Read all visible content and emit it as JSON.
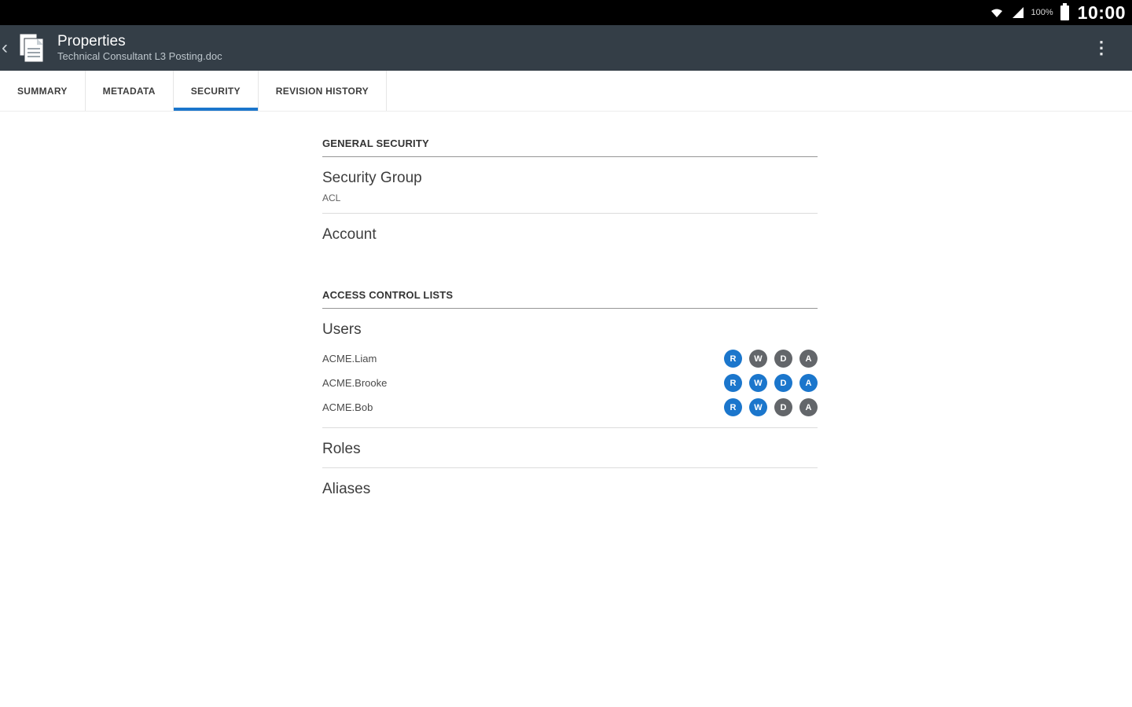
{
  "status_bar": {
    "time": "10:00",
    "battery_level": "100%"
  },
  "app_bar": {
    "back_icon": "‹",
    "title": "Properties",
    "subtitle": "Technical Consultant L3 Posting.doc",
    "overflow_icon": "⋮"
  },
  "tab_bar": {
    "tabs": [
      {
        "label": "SUMMARY",
        "active": false
      },
      {
        "label": "METADATA",
        "active": false
      },
      {
        "label": "SECURITY",
        "active": true
      },
      {
        "label": "REVISION HISTORY",
        "active": false
      }
    ]
  },
  "general_security": {
    "header": "GENERAL SECURITY",
    "security_group_label": "Security Group",
    "security_group_value": "ACL",
    "account_label": "Account"
  },
  "access_control": {
    "header": "ACCESS CONTROL LISTS",
    "users_label": "Users",
    "users": [
      {
        "name": "ACME.Liam",
        "perms": [
          {
            "letter": "R",
            "granted": true
          },
          {
            "letter": "W",
            "granted": false
          },
          {
            "letter": "D",
            "granted": false
          },
          {
            "letter": "A",
            "granted": false
          }
        ]
      },
      {
        "name": "ACME.Brooke",
        "perms": [
          {
            "letter": "R",
            "granted": true
          },
          {
            "letter": "W",
            "granted": true
          },
          {
            "letter": "D",
            "granted": true
          },
          {
            "letter": "A",
            "granted": true
          }
        ]
      },
      {
        "name": "ACME.Bob",
        "perms": [
          {
            "letter": "R",
            "granted": true
          },
          {
            "letter": "W",
            "granted": true
          },
          {
            "letter": "D",
            "granted": false
          },
          {
            "letter": "A",
            "granted": false
          }
        ]
      }
    ],
    "roles_label": "Roles",
    "aliases_label": "Aliases"
  },
  "colors": {
    "accent": "#1b76cc",
    "perm_denied": "#63666a",
    "app_bar_bg": "#343e47"
  }
}
